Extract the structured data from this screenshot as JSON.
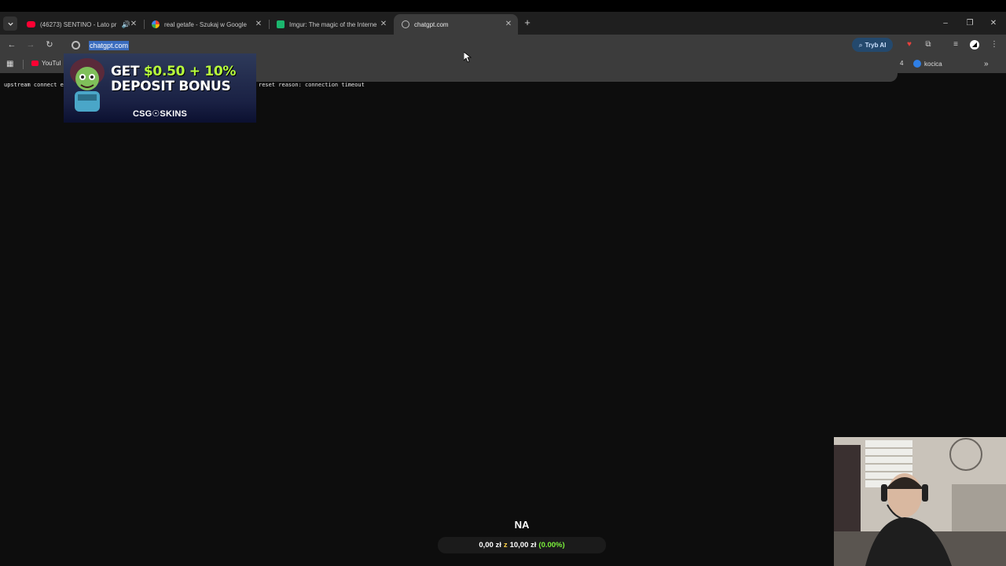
{
  "browser": {
    "tabs": [
      {
        "title": "(46273) SENTINO - Lato pr",
        "favicon": "youtube-icon",
        "color": "#ff0033",
        "audio": true,
        "active": false
      },
      {
        "title": "real getafe - Szukaj w Google",
        "favicon": "google-icon",
        "color": "#ffffff",
        "audio": false,
        "active": false
      },
      {
        "title": "Imgur: The magic of the Interne",
        "favicon": "imgur-icon",
        "color": "#1bb76e",
        "audio": false,
        "active": false
      },
      {
        "title": "chatgpt.com",
        "favicon": "chatgpt-icon",
        "color": "#cccccc",
        "audio": false,
        "active": true
      }
    ],
    "address": "chatgpt.com",
    "ai_mode_label": "Tryb AI",
    "bookmarks": [
      {
        "label": "YouTul",
        "icon": "youtube-icon"
      },
      {
        "label": "kocica",
        "icon": "kocica-icon"
      }
    ],
    "bookmark_partial": "4"
  },
  "page": {
    "error_left": "upstream connect er",
    "error_right": "reset reason: connection timeout"
  },
  "ad": {
    "line1_prefix": "GET ",
    "line1_highlight": "$0.50 + 10%",
    "line2": "DEPOSIT BONUS",
    "brand": "CSG☉SKINS"
  },
  "overlay": {
    "label": "NA",
    "goal_current": "0,00 zł",
    "goal_sep": "z",
    "goal_target": "10,00 zł",
    "goal_pct": "(0.00%)"
  }
}
